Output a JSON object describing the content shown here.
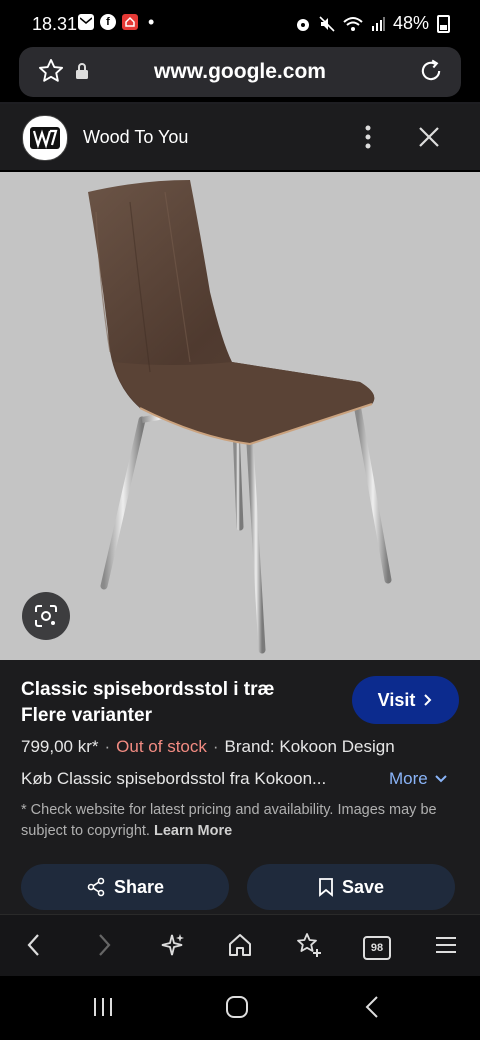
{
  "status_bar": {
    "time": "18.31",
    "battery": "48%",
    "left_icons": [
      "mail-icon",
      "facebook-icon",
      "home-app-icon"
    ],
    "right_icons": [
      "alarm-icon",
      "mute-icon",
      "wifi-icon",
      "signal-icon",
      "battery-icon"
    ]
  },
  "browser": {
    "url": "www.google.com"
  },
  "site": {
    "name": "Wood To You"
  },
  "product": {
    "title_line1": "Classic spisebordsstol i træ",
    "title_line2": "Flere varianter",
    "visit_label": "Visit",
    "price": "799,00 kr*",
    "stock": "Out of stock",
    "brand": "Brand: Kokoon Design",
    "description": "Køb Classic spisebordsstol fra Kokoon...",
    "more_label": "More",
    "disclaimer": "* Check website for latest pricing and availability. Images may be subject to copyright.",
    "learn_more": "Learn More",
    "share_label": "Share",
    "save_label": "Save"
  },
  "bottom_nav": {
    "tab_count": "98",
    "items": [
      "back-icon",
      "forward-icon",
      "sparkle-icon",
      "home-icon",
      "bookmark-add-icon",
      "tabs-icon",
      "menu-icon"
    ]
  },
  "system_nav": [
    "recents-icon",
    "home-circle-icon",
    "back-arrow-icon"
  ],
  "colors": {
    "accent_visit": "#0c2b8e",
    "out_of_stock": "#f28b82",
    "link_blue": "#8ab4f8",
    "panel_bg": "#1c1c1e"
  }
}
